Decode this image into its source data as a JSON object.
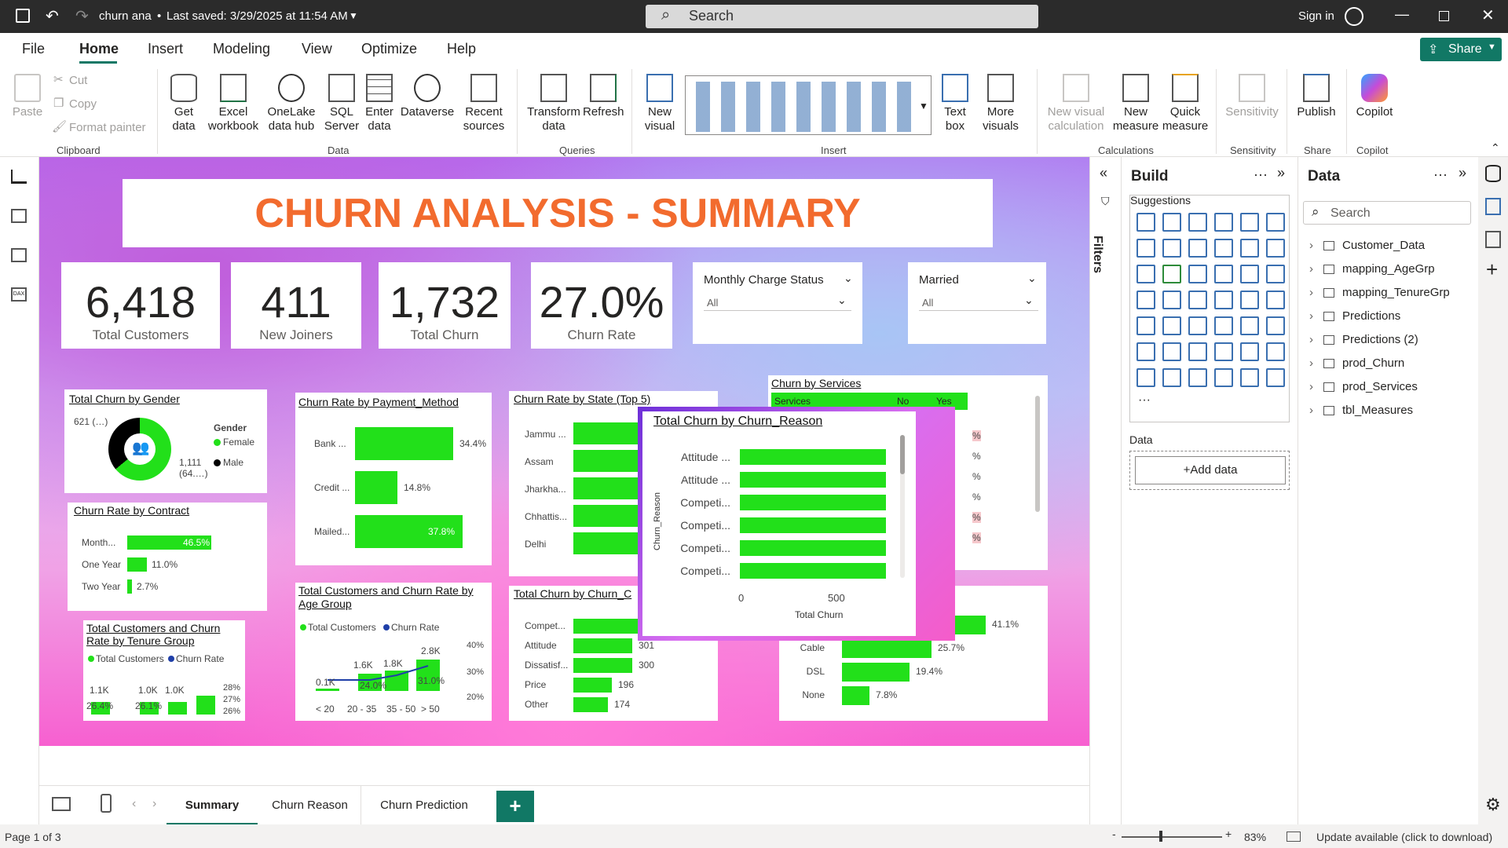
{
  "titlebar": {
    "file_name": "churn ana",
    "saved": "Last saved: 3/29/2025 at 11:54 AM",
    "search_placeholder": "Search",
    "sign_in": "Sign in"
  },
  "menu": [
    "File",
    "Home",
    "Insert",
    "Modeling",
    "View",
    "Optimize",
    "Help"
  ],
  "share_label": "Share",
  "ribbon": {
    "clipboard": {
      "paste": "Paste",
      "cut": "Cut",
      "copy": "Copy",
      "format_painter": "Format painter",
      "group": "Clipboard"
    },
    "data": {
      "get_data": "Get data",
      "excel": "Excel workbook",
      "onelake": "OneLake data hub",
      "sql": "SQL Server",
      "enter": "Enter data",
      "dataverse": "Dataverse",
      "recent": "Recent sources",
      "group": "Data"
    },
    "queries": {
      "transform": "Transform data",
      "refresh": "Refresh",
      "group": "Queries"
    },
    "insert": {
      "new_visual": "New visual",
      "text_box": "Text box",
      "more_visuals": "More visuals",
      "group": "Insert"
    },
    "calculations": {
      "new_visual_calc": "New visual calculation",
      "new_measure": "New measure",
      "quick_measure": "Quick measure",
      "group": "Calculations"
    },
    "sensitivity": {
      "label": "Sensitivity",
      "group": "Sensitivity"
    },
    "share": {
      "publish": "Publish",
      "group": "Share"
    },
    "copilot": {
      "label": "Copilot",
      "group": "Copilot"
    }
  },
  "report": {
    "title": "CHURN ANALYSIS - SUMMARY",
    "kpis": [
      {
        "value": "6,418",
        "label": "Total Customers"
      },
      {
        "value": "411",
        "label": "New Joiners"
      },
      {
        "value": "1,732",
        "label": "Total Churn"
      },
      {
        "value": "27.0%",
        "label": "Churn Rate"
      }
    ],
    "slicers": [
      {
        "title": "Monthly Charge Status",
        "value": "All"
      },
      {
        "title": "Married",
        "value": "All"
      }
    ],
    "gender": {
      "title": "Total Churn by Gender",
      "legend_title": "Gender",
      "female": "Female",
      "male": "Male",
      "label_female": "1,111 (64.…)",
      "label_male": "621 (…)",
      "female_color": "#22e01a",
      "male_color": "#000000"
    },
    "contract": {
      "title": "Churn Rate by Contract",
      "rows": [
        {
          "label": "Month...",
          "value": 46.5,
          "text": "46.5%"
        },
        {
          "label": "One Year",
          "value": 11.0,
          "text": "11.0%"
        },
        {
          "label": "Two Year",
          "value": 2.7,
          "text": "2.7%"
        }
      ]
    },
    "payment": {
      "title": "Churn Rate by Payment_Method",
      "rows": [
        {
          "label": "Bank ...",
          "value": 34.4,
          "text": "34.4%"
        },
        {
          "label": "Credit ...",
          "value": 14.8,
          "text": "14.8%"
        },
        {
          "label": "Mailed...",
          "value": 37.8,
          "text": "37.8%"
        }
      ]
    },
    "state": {
      "title": "Churn Rate by State (Top 5)",
      "rows": [
        "Jammu ...",
        "Assam",
        "Jharkha...",
        "Chhattis...",
        "Delhi"
      ]
    },
    "services": {
      "title": "Churn by Services",
      "headers": [
        "Services",
        "No",
        "Yes"
      ],
      "cells": [
        "%",
        "%",
        "%",
        "%",
        "%",
        "%"
      ]
    },
    "reason_popup": {
      "title": "Total Churn by Churn_Reason",
      "ylabel": "Churn_Reason",
      "xlabel": "Total Churn",
      "rows": [
        "Attitude ...",
        "Attitude ...",
        "Competi...",
        "Competi...",
        "Competi...",
        "Competi..."
      ],
      "ticks": [
        "0",
        "500"
      ]
    },
    "reason_cat": {
      "title": "Total Churn by Churn_C",
      "rows": [
        {
          "label": "Compet...",
          "value": null,
          "text": ""
        },
        {
          "label": "Attitude",
          "value": 301,
          "text": "301"
        },
        {
          "label": "Dissatisf...",
          "value": 300,
          "text": "300"
        },
        {
          "label": "Price",
          "value": 196,
          "text": "196"
        },
        {
          "label": "Other",
          "value": 174,
          "text": "174"
        }
      ]
    },
    "internet": {
      "rows": [
        {
          "label": "",
          "value": 41.1,
          "text": "41.1%"
        },
        {
          "label": "Cable",
          "value": 25.7,
          "text": "25.7%"
        },
        {
          "label": "DSL",
          "value": 19.4,
          "text": "19.4%"
        },
        {
          "label": "None",
          "value": 7.8,
          "text": "7.8%"
        }
      ]
    },
    "age": {
      "title": "Total Customers and Churn Rate by Age Group",
      "legend_a": "Total Customers",
      "legend_b": "Churn Rate",
      "cats": [
        "< 20",
        "20 - 35",
        "35 - 50",
        "> 50"
      ],
      "bar_labels": [
        "0.1K",
        "1.6K",
        "1.8K",
        "2.8K"
      ],
      "line_labels": [
        "",
        "24.0%",
        "",
        "31.0%"
      ],
      "yticks": [
        "40%",
        "30%",
        "20%"
      ]
    },
    "tenure": {
      "title": "Total Customers and Churn Rate by Tenure Group",
      "legend_a": "Total Customers",
      "legend_b": "Churn Rate",
      "bar_labels": [
        "1.1K",
        "1.0K",
        "1.0K"
      ],
      "line_labels": [
        "26.4%",
        "26.1%"
      ],
      "yticks": [
        "28%",
        "27%",
        "26%"
      ]
    }
  },
  "filters_label": "Filters",
  "build": {
    "title": "Build",
    "suggestions": "Suggestions",
    "data_label": "Data",
    "add_data": "+Add data"
  },
  "datapane": {
    "title": "Data",
    "search": "Search",
    "tables": [
      "Customer_Data",
      "mapping_AgeGrp",
      "mapping_TenureGrp",
      "Predictions",
      "Predictions (2)",
      "prod_Churn",
      "prod_Services",
      "tbl_Measures"
    ]
  },
  "tabs": [
    "Summary",
    "Churn Reason",
    "Churn Prediction"
  ],
  "status": {
    "page": "Page 1 of 3",
    "zoom": "83%",
    "update": "Update available (click to download)"
  }
}
